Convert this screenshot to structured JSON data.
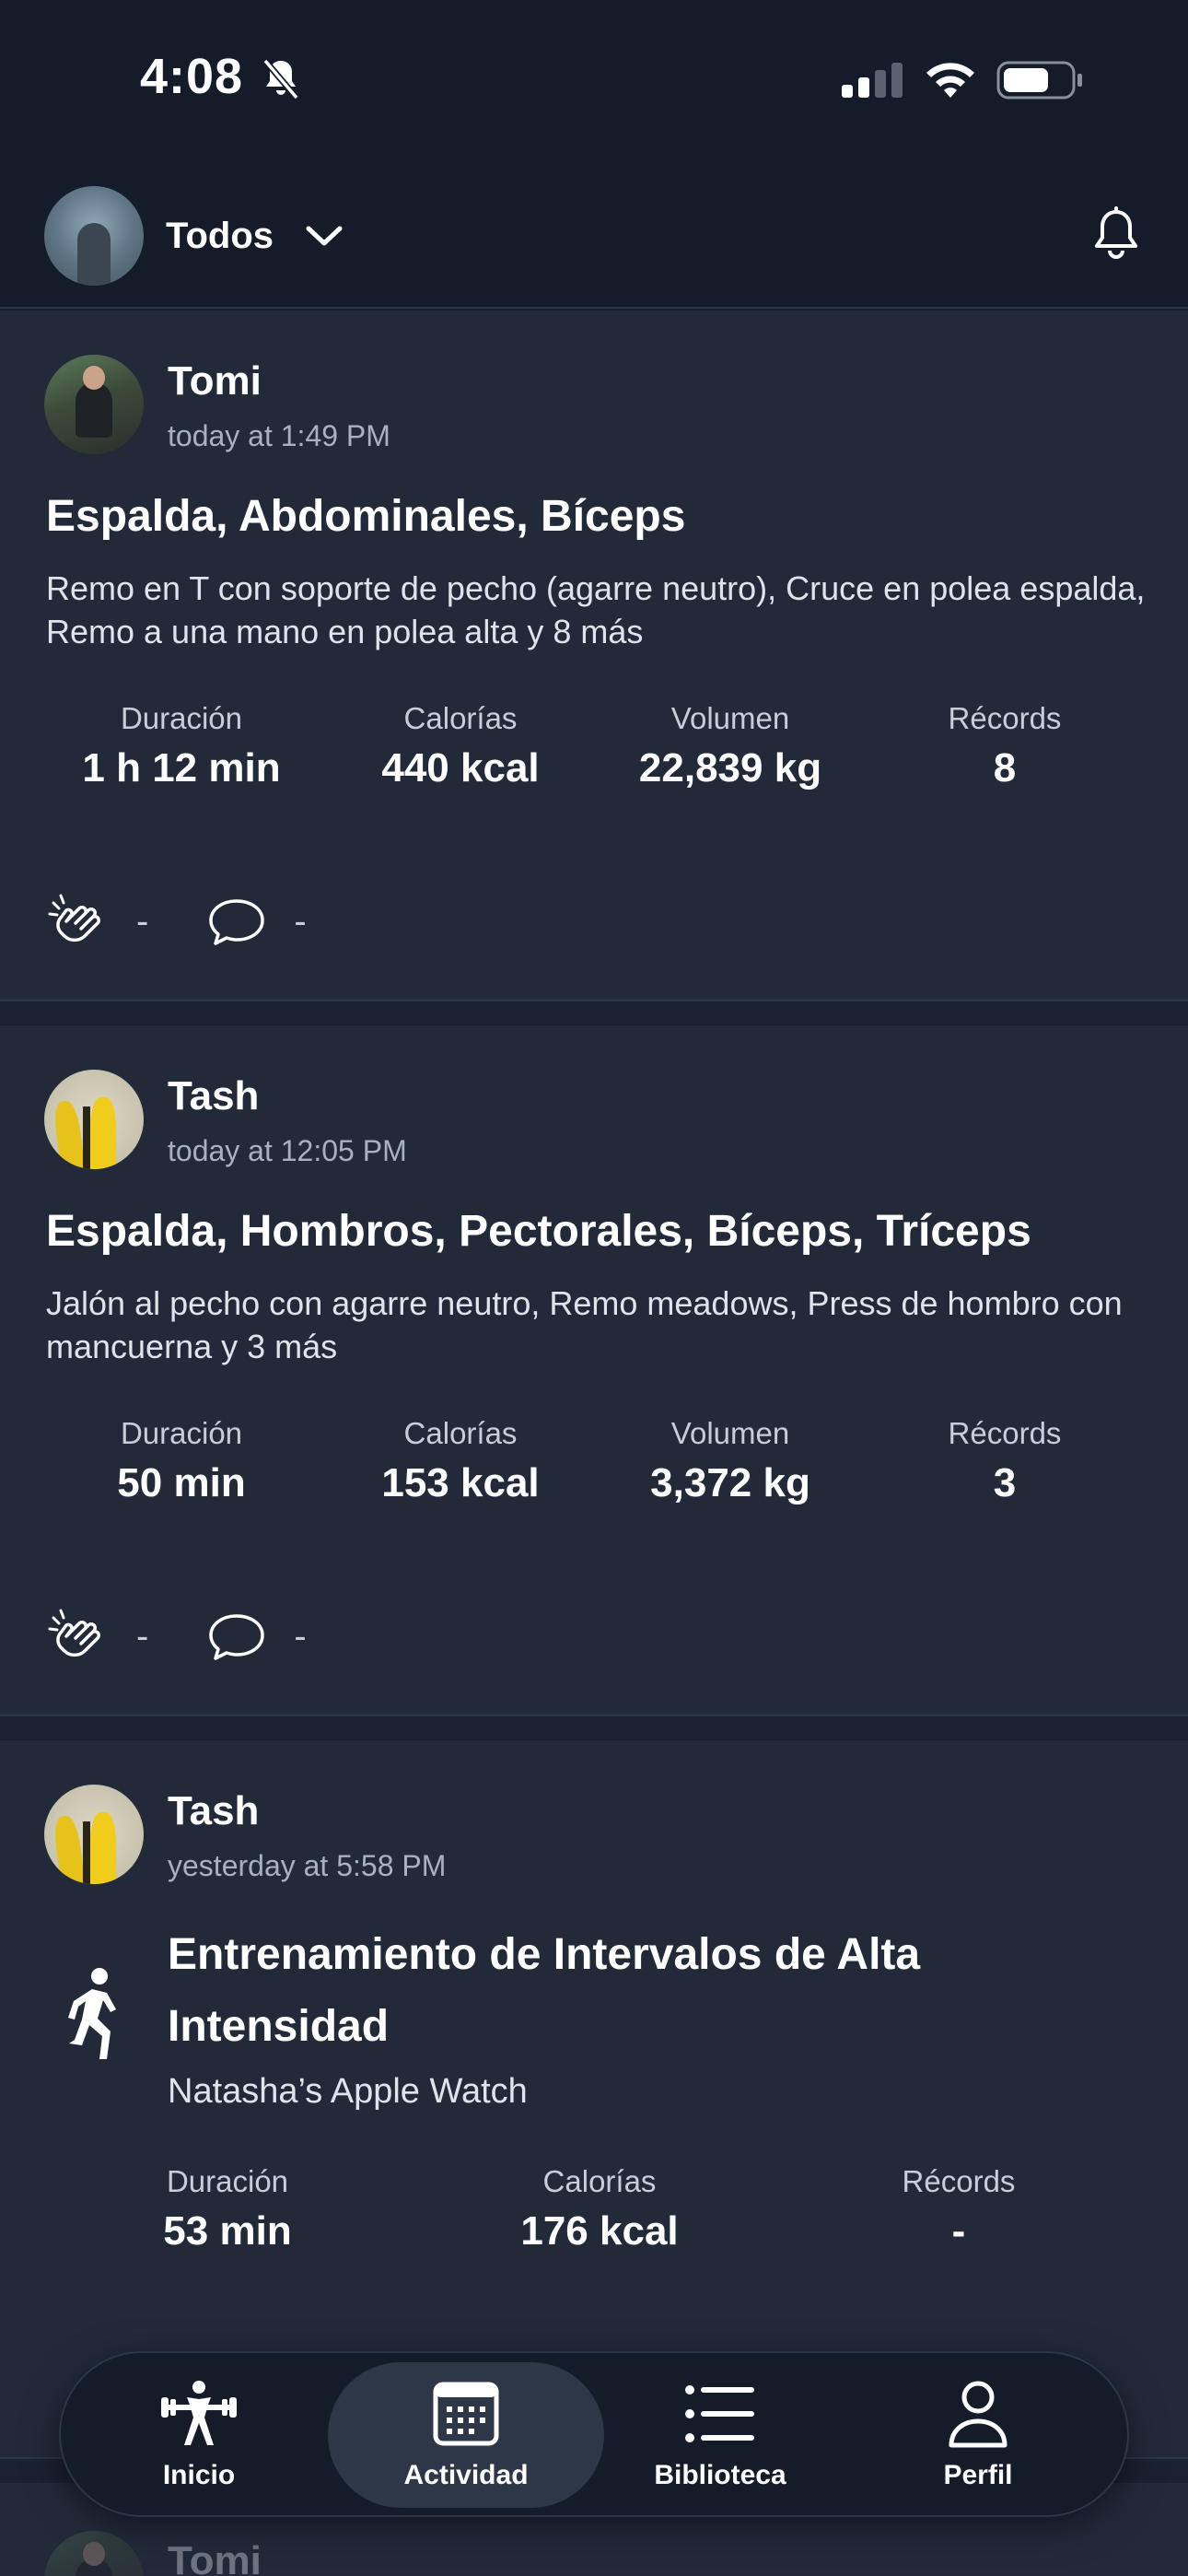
{
  "status_bar": {
    "time": "4:08",
    "icons": [
      "bell-slash-icon",
      "cellular-signal-icon",
      "wifi-icon",
      "battery-icon"
    ]
  },
  "header": {
    "filter_label": "Todos",
    "icons": [
      "chevron-down-icon",
      "bell-icon"
    ]
  },
  "feed": [
    {
      "user": "Tomi",
      "time": "today at 1:49 PM",
      "title": "Espalda, Abdominales, Bíceps",
      "description": "Remo en T con soporte de pecho (agarre neutro), Cruce en polea espalda, Remo a una mano en polea alta y 8 más",
      "stats": [
        {
          "label": "Duración",
          "value": "1 h 12 min"
        },
        {
          "label": "Calorías",
          "value": "440 kcal"
        },
        {
          "label": "Volumen",
          "value": "22,839 kg"
        },
        {
          "label": "Récords",
          "value": "8"
        }
      ],
      "claps": "-",
      "comments": "-"
    },
    {
      "user": "Tash",
      "time": "today at 12:05 PM",
      "title": "Espalda, Hombros, Pectorales, Bíceps, Tríceps",
      "description": "Jalón al pecho con agarre neutro, Remo meadows, Press de hombro con mancuerna y 3 más",
      "stats": [
        {
          "label": "Duración",
          "value": "50 min"
        },
        {
          "label": "Calorías",
          "value": "153 kcal"
        },
        {
          "label": "Volumen",
          "value": "3,372 kg"
        },
        {
          "label": "Récords",
          "value": "3"
        }
      ],
      "claps": "-",
      "comments": "-"
    },
    {
      "user": "Tash",
      "time": "yesterday at 5:58 PM",
      "title_line1": "Entrenamiento de Intervalos de Alta",
      "title_line2": "Intensidad",
      "device": "Natasha’s Apple Watch",
      "stats": [
        {
          "label": "Duración",
          "value": "53 min"
        },
        {
          "label": "Calorías",
          "value": "176 kcal"
        },
        {
          "label": "Récords",
          "value": "-"
        }
      ]
    },
    {
      "user": "Tomi"
    }
  ],
  "bottom_nav": [
    {
      "label": "Inicio",
      "icon": "weightlifter-icon"
    },
    {
      "label": "Actividad",
      "icon": "calendar-icon",
      "active": true
    },
    {
      "label": "Biblioteca",
      "icon": "list-icon"
    },
    {
      "label": "Perfil",
      "icon": "person-icon"
    }
  ],
  "colors": {
    "background": "#1a2130",
    "card": "#222a3a",
    "header": "#141b29",
    "muted_text": "#a9b1bf",
    "active_nav": "#2e3748"
  }
}
